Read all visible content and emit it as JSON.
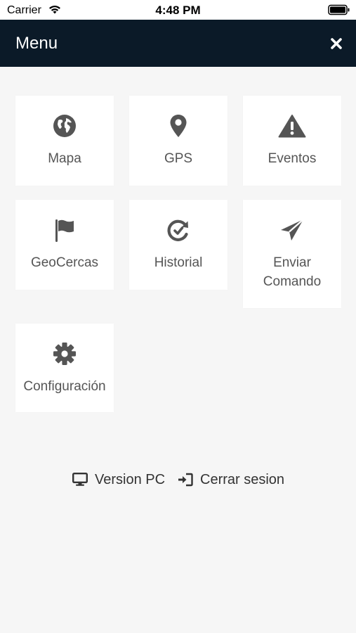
{
  "status_bar": {
    "carrier": "Carrier",
    "time": "4:48 PM"
  },
  "header": {
    "title": "Menu",
    "close_icon": "close-icon"
  },
  "menu": {
    "items": [
      {
        "label": "Mapa",
        "icon": "globe-icon"
      },
      {
        "label": "GPS",
        "icon": "map-pin-icon"
      },
      {
        "label": "Eventos",
        "icon": "warning-icon"
      },
      {
        "label": "GeoCercas",
        "icon": "flag-icon"
      },
      {
        "label": "Historial",
        "icon": "history-icon"
      },
      {
        "label": "Enviar\nComando",
        "icon": "send-icon"
      },
      {
        "label": "Configuración",
        "icon": "gear-icon"
      }
    ]
  },
  "footer": {
    "version_pc": "Version PC",
    "logout": "Cerrar sesion"
  },
  "colors": {
    "navbar": "#0b1a28",
    "background": "#f6f6f6",
    "icon": "#555555"
  }
}
